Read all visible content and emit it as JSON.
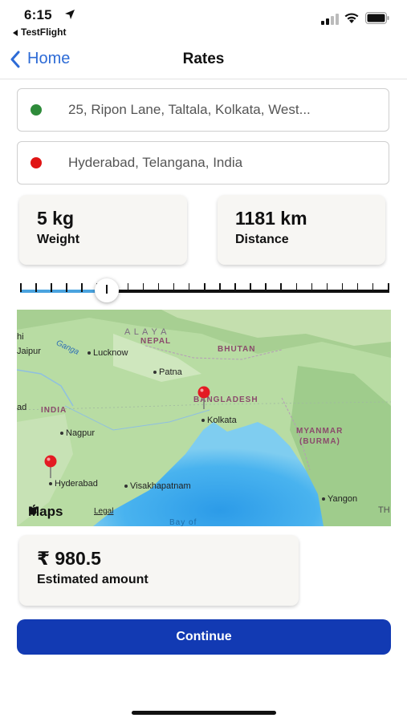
{
  "status_bar": {
    "time": "6:15",
    "back_app": "TestFlight"
  },
  "nav": {
    "back_label": "Home",
    "title": "Rates"
  },
  "pickup": {
    "address": "25, Ripon Lane, Taltala, Kolkata, West...",
    "dot_color": "#2e8b3a"
  },
  "dropoff": {
    "address": "Hyderabad, Telangana, India",
    "dot_color": "#e01414"
  },
  "weight": {
    "value": "5 kg",
    "label": "Weight"
  },
  "distance": {
    "value": "1181 km",
    "label": "Distance"
  },
  "slider": {
    "ticks": 25,
    "selected_tick": 6,
    "fill_color": "#4aa3df"
  },
  "map": {
    "labels": {
      "hi": "hi",
      "jaipur": "Jaipur",
      "ganga": "Ganga",
      "lucknow": "Lucknow",
      "nepal": "NEPAL",
      "alaya": "A L A Y A",
      "bhutan": "BHUTAN",
      "patna": "Patna",
      "bangladesh": "BANGLADESH",
      "ad": "ad",
      "india": "INDIA",
      "kolkata": "Kolkata",
      "myanmar": "MYANMAR",
      "burma": "(BURMA)",
      "nagpur": "Nagpur",
      "hyderabad": "Hyderabad",
      "visakhapatnam": "Visakhapatnam",
      "yangon": "Yangon",
      "th": "TH",
      "bay": "Bay of"
    },
    "logo": "Maps",
    "legal": "Legal"
  },
  "estimate": {
    "value": "₹ 980.5",
    "label": "Estimated amount"
  },
  "continue_label": "Continue"
}
